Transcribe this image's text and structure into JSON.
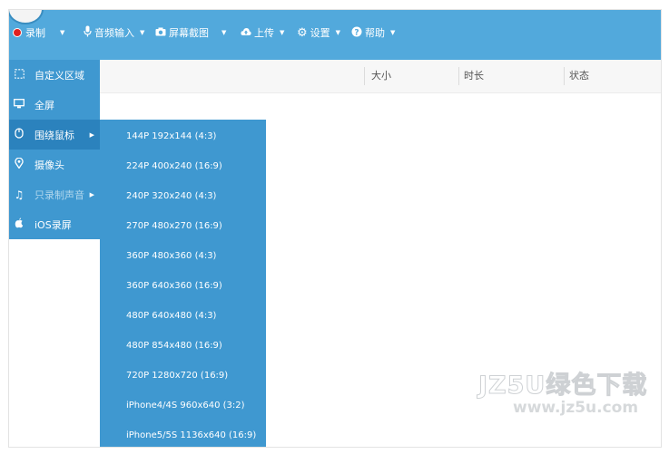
{
  "toolbar": {
    "items": [
      {
        "label": "录制",
        "icon": "record-dot-icon"
      },
      {
        "label": "音频输入",
        "icon": "microphone-icon"
      },
      {
        "label": "屏幕截图",
        "icon": "camera-icon"
      },
      {
        "label": "上传",
        "icon": "cloud-upload-icon"
      },
      {
        "label": "设置",
        "icon": "gear-icon"
      },
      {
        "label": "帮助",
        "icon": "help-icon"
      }
    ],
    "caret": "▼",
    "color": "#52a9dc"
  },
  "table": {
    "columns": [
      "大小",
      "时长",
      "状态"
    ]
  },
  "record_menu": {
    "items": [
      {
        "label": "自定义区域",
        "icon": "region-select-icon"
      },
      {
        "label": "全屏",
        "icon": "monitor-icon"
      },
      {
        "label": "围绕鼠标",
        "icon": "mouse-icon",
        "has_submenu": true
      },
      {
        "label": "摄像头",
        "icon": "location-pin-icon"
      },
      {
        "label": "只录制声音",
        "icon": "music-note-icon",
        "has_submenu": true
      },
      {
        "label": "iOS录屏",
        "icon": "apple-icon"
      }
    ],
    "arrow": "▶",
    "color": "#3f98d0"
  },
  "resolution_submenu": {
    "items": [
      "144P 192x144 (4:3)",
      "224P 400x240 (16:9)",
      "240P 320x240 (4:3)",
      "270P 480x270 (16:9)",
      "360P 480x360 (4:3)",
      "360P 640x360 (16:9)",
      "480P 640x480 (4:3)",
      "480P 854x480 (16:9)",
      "720P 1280x720 (16:9)",
      "iPhone4/4S 960x640 (3:2)",
      "iPhone5/5S 1136x640 (16:9)"
    ]
  },
  "watermark": {
    "line1": "JZ5U绿色下载",
    "line2": "www.jz5u.com"
  }
}
